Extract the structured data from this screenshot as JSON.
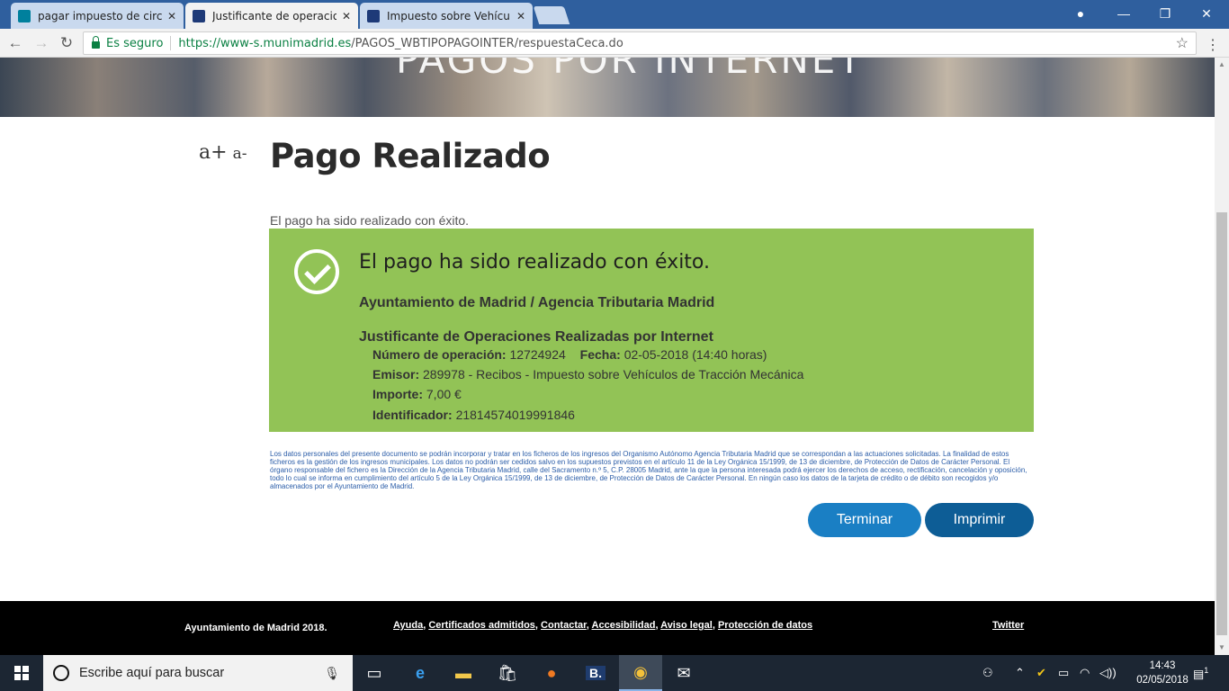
{
  "browser": {
    "tabs": [
      {
        "title": "pagar impuesto de circula",
        "active": false
      },
      {
        "title": "Justificante de operacione",
        "active": true
      },
      {
        "title": "Impuesto sobre Vehículos",
        "active": false
      }
    ],
    "omnibox": {
      "secure_label": "Es seguro",
      "url_host": "https://www-s.munimadrid.es",
      "url_path": "/PAGOS_WBTIPOPAGOINTER/respuestaCeca.do"
    }
  },
  "page": {
    "banner_text": "PAGOS POR INTERNET",
    "font_increase": "a+",
    "font_decrease": "a-",
    "title": "Pago Realizado",
    "intro": "El pago ha sido realizado con éxito.",
    "success": {
      "heading": "El pago ha sido realizado con éxito.",
      "organization": "Ayuntamiento de Madrid / Agencia Tributaria Madrid",
      "justificante": "Justificante de Operaciones Realizadas por Internet",
      "op_label": "Número de operación:",
      "op_value": "12724924",
      "date_label": "Fecha:",
      "date_value": "02-05-2018 (14:40 horas)",
      "emisor_label": "Emisor:",
      "emisor_value": "289978 - Recibos - Impuesto sobre Vehículos de Tracción Mecánica",
      "importe_label": "Importe:",
      "importe_value": "7,00 €",
      "id_label": "Identificador:",
      "id_value": "21814574019991846"
    },
    "legal": "Los datos personales del presente documento se podrán incorporar y tratar en los ficheros de los ingresos del Organismo Autónomo Agencia Tributaria Madrid que se correspondan a las actuaciones solicitadas. La finalidad de estos ficheros es la gestión de los ingresos municipales. Los datos no podrán ser cedidos salvo en los supuestos previstos en el artículo 11 de la Ley Orgánica 15/1999, de 13 de diciembre, de Protección de Datos de Carácter Personal. El órgano responsable del fichero es la Dirección de la Agencia Tributaria Madrid, calle del Sacramento n.º 5, C.P. 28005 Madrid, ante la que la persona interesada podrá ejercer los derechos de acceso, rectificación, cancelación y oposición, todo lo cual se informa en cumplimiento del artículo 5 de la Ley Orgánica 15/1999, de 13 de diciembre, de Protección de Datos de Carácter Personal. En ningún caso los datos de la tarjeta de crédito o de débito son recogidos y/o almacenados por el Ayuntamiento de Madrid.",
    "btn_terminar": "Terminar",
    "btn_imprimir": "Imprimir"
  },
  "footer": {
    "copyright": "Ayuntamiento de Madrid 2018.",
    "links": [
      "Ayuda",
      "Certificados admitidos",
      "Contactar",
      "Accesibilidad",
      "Aviso legal",
      "Protección de datos"
    ],
    "twitter": "Twitter"
  },
  "taskbar": {
    "search_placeholder": "Escribe aquí para buscar",
    "time": "14:43",
    "date": "02/05/2018",
    "notification_count": "1"
  },
  "colors": {
    "success_bg": "#92c356",
    "button_primary": "#1a7fc4",
    "button_dark": "#0d5d96",
    "tabstrip": "#2f5f9e"
  }
}
